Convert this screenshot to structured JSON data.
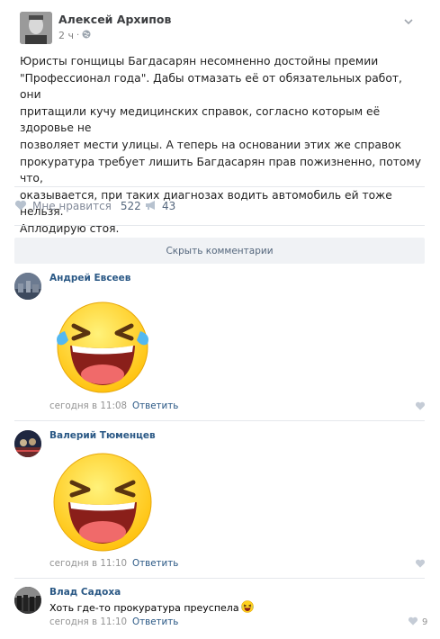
{
  "post": {
    "author": "Алексей Архипов",
    "time": "2 ч",
    "dot": "·",
    "text": "Юристы гонщицы Багдасарян несомненно достойны премии\n\"Профессионал года\". Дабы отмазать её от обязательных работ, они\nпритащили кучу медицинских справок, согласно которым её здоровье не\nпозволяет мести улицы. А теперь на основании этих же справок\nпрокуратура требует лишить Багдасарян прав пожизненно, потому что,\nоказывается, при таких диагнозах водить автомобиль ей тоже нельзя.\nАплодирую стоя."
  },
  "actions": {
    "like_label": "Мне нравится",
    "like_count": "522",
    "share_count": "43"
  },
  "comments_toggle": "Скрыть комментарии",
  "comments": [
    {
      "author": "Андрей Евсеев",
      "date": "сегодня в 11:08",
      "reply": "Ответить",
      "sticker": "laughing-sticker"
    },
    {
      "author": "Валерий Тюменцев",
      "date": "сегодня в 11:10",
      "reply": "Ответить",
      "sticker": "laughing-sticker"
    },
    {
      "author": "Влад Садоха",
      "text": "Хоть где-то прокуратура преуспела",
      "date": "сегодня в 11:10",
      "reply": "Ответить",
      "likes": "9"
    }
  ],
  "colors": {
    "link": "#2a5885",
    "muted": "#939393",
    "button_bg": "#f0f2f5",
    "sticker_face": "#ffd21f"
  }
}
